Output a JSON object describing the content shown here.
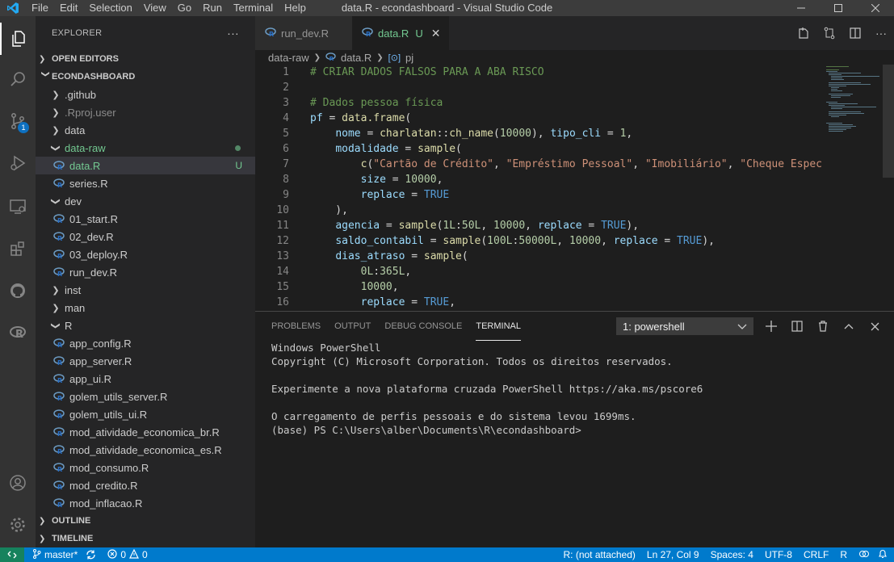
{
  "window": {
    "title": "data.R - econdashboard - Visual Studio Code",
    "menu": [
      "File",
      "Edit",
      "Selection",
      "View",
      "Go",
      "Run",
      "Terminal",
      "Help"
    ]
  },
  "activity": {
    "scm_badge": "1"
  },
  "sidebar": {
    "header": "EXPLORER",
    "more": "···",
    "open_editors": "OPEN EDITORS",
    "project": "ECONDASHBOARD",
    "items": [
      {
        "label": ".github",
        "type": "folder"
      },
      {
        "label": ".Rproj.user",
        "type": "folder"
      },
      {
        "label": "data",
        "type": "folder"
      },
      {
        "label": "data-raw",
        "type": "folder-open"
      },
      {
        "label": "data.R",
        "type": "file"
      },
      {
        "label": "series.R",
        "type": "file"
      },
      {
        "label": "dev",
        "type": "folder-open"
      },
      {
        "label": "01_start.R",
        "type": "file"
      },
      {
        "label": "02_dev.R",
        "type": "file"
      },
      {
        "label": "03_deploy.R",
        "type": "file"
      },
      {
        "label": "run_dev.R",
        "type": "file"
      },
      {
        "label": "inst",
        "type": "folder"
      },
      {
        "label": "man",
        "type": "folder"
      },
      {
        "label": "R",
        "type": "folder-open"
      },
      {
        "label": "app_config.R",
        "type": "file"
      },
      {
        "label": "app_server.R",
        "type": "file"
      },
      {
        "label": "app_ui.R",
        "type": "file"
      },
      {
        "label": "golem_utils_server.R",
        "type": "file"
      },
      {
        "label": "golem_utils_ui.R",
        "type": "file"
      },
      {
        "label": "mod_atividade_economica_br.R",
        "type": "file"
      },
      {
        "label": "mod_atividade_economica_es.R",
        "type": "file"
      },
      {
        "label": "mod_consumo.R",
        "type": "file"
      },
      {
        "label": "mod_credito.R",
        "type": "file"
      },
      {
        "label": "mod_inflacao.R",
        "type": "file"
      }
    ],
    "untracked_marker": "U",
    "outline": "OUTLINE",
    "timeline": "TIMELINE"
  },
  "tabs": [
    {
      "label": "run_dev.R"
    },
    {
      "label": "data.R",
      "status": "U"
    }
  ],
  "breadcrumb": [
    "data-raw",
    "data.R",
    "pj"
  ],
  "editor": {
    "line_numbers": [
      "1",
      "2",
      "3",
      "4",
      "5",
      "6",
      "7",
      "8",
      "9",
      "10",
      "11",
      "12",
      "13",
      "14",
      "15",
      "16"
    ],
    "lines": {
      "l1": "# CRIAR DADOS FALSOS PARA A ABA RISCO",
      "l3": "# Dados pessoa física",
      "l7_a": "\"Cartão de Crédito\"",
      "l7_b": "\"Empréstimo Pessoal\"",
      "l7_c": "\"Imobiliário\"",
      "l7_d": "\"Cheque Espec"
    }
  },
  "panel": {
    "tabs": [
      "PROBLEMS",
      "OUTPUT",
      "DEBUG CONSOLE",
      "TERMINAL"
    ],
    "terminal_select": "1: powershell",
    "terminal_lines": [
      "Windows PowerShell",
      "Copyright (C) Microsoft Corporation. Todos os direitos reservados.",
      "",
      "Experimente a nova plataforma cruzada PowerShell https://aka.ms/pscore6",
      "",
      "O carregamento de perfis pessoais e do sistema levou 1699ms.",
      "(base) PS C:\\Users\\alber\\Documents\\R\\econdashboard>"
    ]
  },
  "status": {
    "branch": "master*",
    "errors": "0",
    "warnings": "0",
    "r_status": "R: (not attached)",
    "position": "Ln 27, Col 9",
    "spaces": "Spaces: 4",
    "encoding": "UTF-8",
    "eol": "CRLF",
    "language": "R"
  },
  "colors": {
    "accent": "#007acc",
    "untracked": "#73c991"
  }
}
